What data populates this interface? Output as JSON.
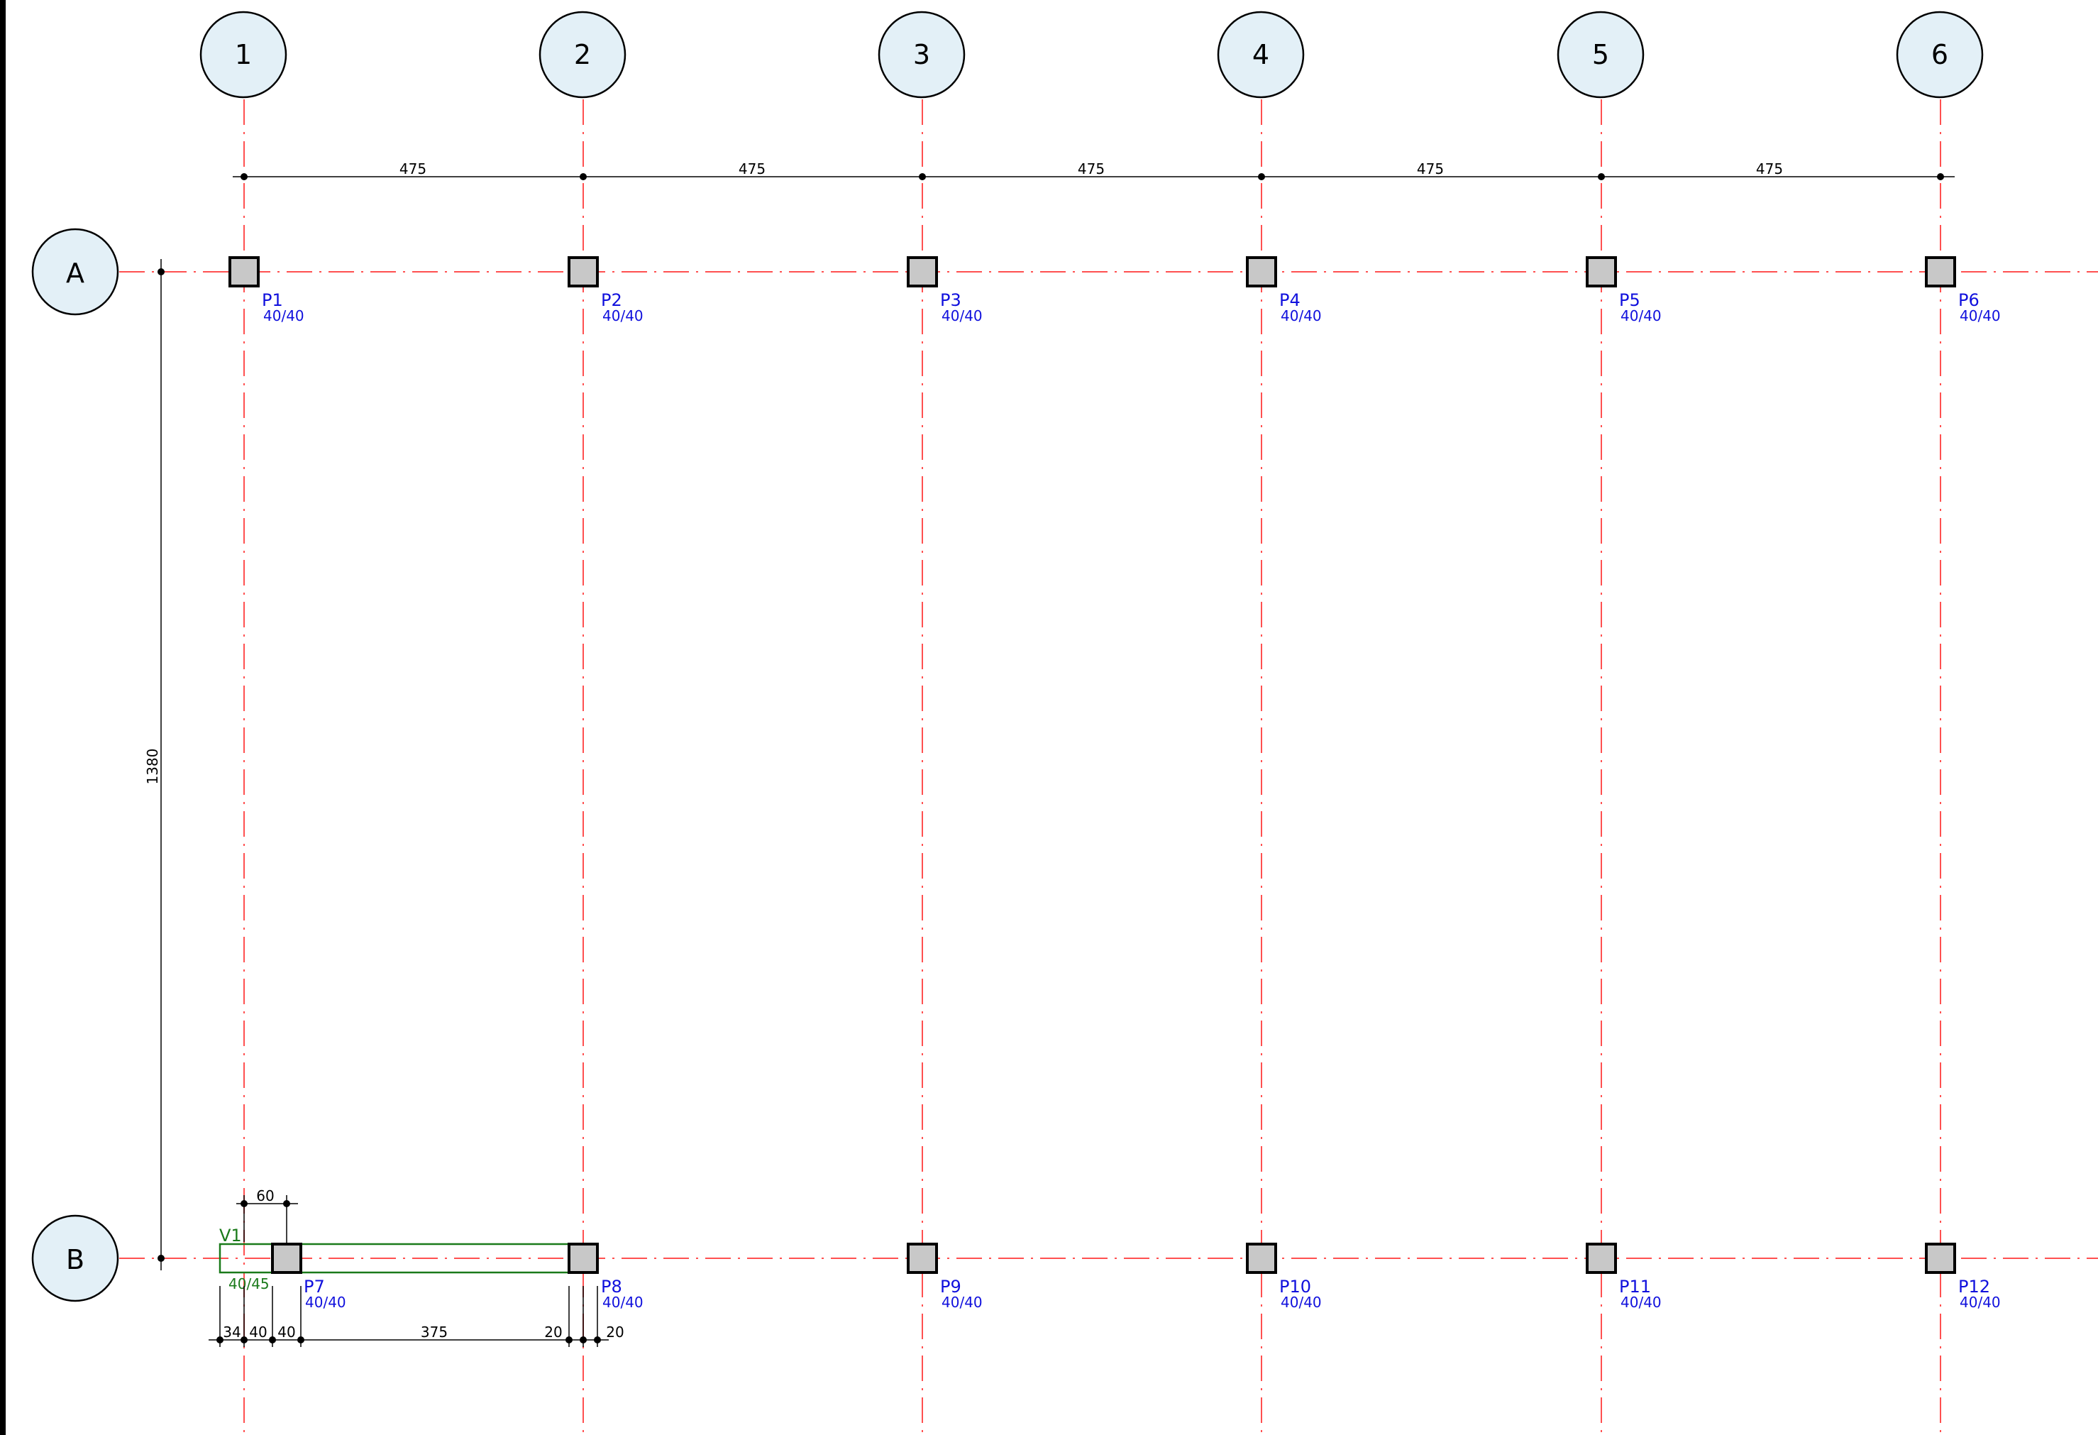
{
  "grid": {
    "columns_axes": [
      "1",
      "2",
      "3",
      "4",
      "5",
      "6"
    ],
    "rows_axes": [
      "A",
      "B"
    ],
    "spacing_labels": [
      "475",
      "475",
      "475",
      "475",
      "475"
    ],
    "vertical_span_label": "1380"
  },
  "columns": [
    {
      "name": "P1",
      "size": "40/40"
    },
    {
      "name": "P2",
      "size": "40/40"
    },
    {
      "name": "P3",
      "size": "40/40"
    },
    {
      "name": "P4",
      "size": "40/40"
    },
    {
      "name": "P5",
      "size": "40/40"
    },
    {
      "name": "P6",
      "size": "40/40"
    },
    {
      "name": "P7",
      "size": "40/40"
    },
    {
      "name": "P8",
      "size": "40/40"
    },
    {
      "name": "P9",
      "size": "40/40"
    },
    {
      "name": "P10",
      "size": "40/40"
    },
    {
      "name": "P11",
      "size": "40/40"
    },
    {
      "name": "P12",
      "size": "40/40"
    }
  ],
  "beam": {
    "name": "V1",
    "size": "40/45"
  },
  "local_dims": {
    "top": "60",
    "bottom": [
      "34",
      "40",
      "40",
      "375",
      "20",
      "20"
    ]
  },
  "colors": {
    "grid_line": "#ff5050",
    "bubble_fill": "#e3f0f7",
    "column_label": "#1010dd",
    "beam": "#1a7a1a"
  }
}
